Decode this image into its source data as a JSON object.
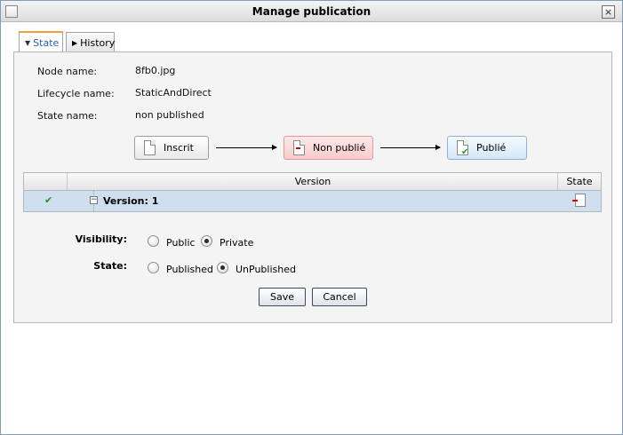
{
  "window": {
    "title": "Manage publication",
    "close_glyph": "×"
  },
  "tabs": [
    {
      "label": "State",
      "active": true
    },
    {
      "label": "History",
      "active": false
    }
  ],
  "info": {
    "node_name_label": "Node name:",
    "node_name_value": "8fb0.jpg",
    "lifecycle_label": "Lifecycle name:",
    "lifecycle_value": "StaticAndDirect",
    "state_label": "State name:",
    "state_value": "non published"
  },
  "lifecycle_states": [
    {
      "label": "Inscrit",
      "icon": "document-icon"
    },
    {
      "label": "Non publié",
      "icon": "document-unpublished-icon"
    },
    {
      "label": "Publié",
      "icon": "document-published-icon"
    }
  ],
  "versions_table": {
    "columns": [
      "",
      "Version",
      "State"
    ],
    "rows": [
      {
        "selected_icon": "checkmark-icon",
        "label": "Version: 1",
        "state_icon": "document-unpublished-icon"
      }
    ]
  },
  "form": {
    "visibility_label": "Visibility:",
    "visibility_options": [
      "Public",
      "Private"
    ],
    "visibility_selected": "Private",
    "state_label": "State:",
    "state_options": [
      "Published",
      "UnPublished"
    ],
    "state_selected": "UnPublished"
  },
  "buttons": {
    "save": "Save",
    "cancel": "Cancel"
  },
  "colors": {
    "active_tab_accent": "#f0a030",
    "unpublished_state": "#f8cccc",
    "published_state": "#d6e8f8",
    "selected_row": "#cfdfee"
  }
}
